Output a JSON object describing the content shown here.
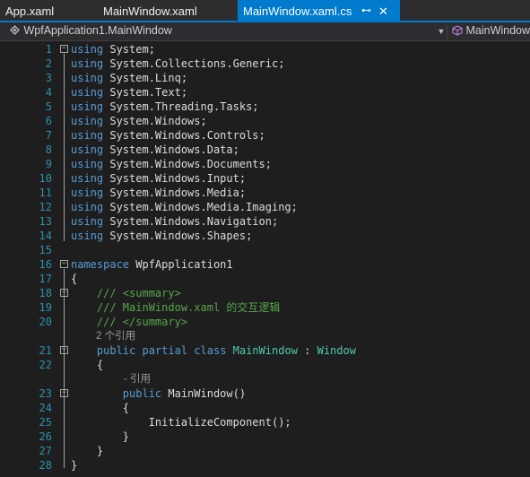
{
  "tabs": [
    {
      "label": "App.xaml",
      "active": false
    },
    {
      "label": "MainWindow.xaml",
      "active": false
    },
    {
      "label": "MainWindow.xaml.cs",
      "active": true
    }
  ],
  "navbar": {
    "class_icon": "cs-class-icon",
    "type_path": "WpfApplication1.MainWindow",
    "member_icon": "cube-member-icon",
    "member": "MainWindow"
  },
  "code_lines": [
    "using System;",
    "using System.Collections.Generic;",
    "using System.Linq;",
    "using System.Text;",
    "using System.Threading.Tasks;",
    "using System.Windows;",
    "using System.Windows.Controls;",
    "using System.Windows.Data;",
    "using System.Windows.Documents;",
    "using System.Windows.Input;",
    "using System.Windows.Media;",
    "using System.Windows.Media.Imaging;",
    "using System.Windows.Navigation;",
    "using System.Windows.Shapes;",
    "",
    "namespace WpfApplication1",
    "{",
    "    /// <summary>",
    "    /// MainWindow.xaml 的交互逻辑",
    "    /// </summary>",
    "    public partial class MainWindow : Window",
    "    {",
    "        public MainWindow()",
    "        {",
    "            InitializeComponent();",
    "        }",
    "    }",
    "}"
  ],
  "codelens": {
    "class_refs": "2 个引用",
    "ctor_refs": "- 引用"
  },
  "colors": {
    "keyword": "#569cd6",
    "comment": "#57a64a",
    "type": "#4ec9b0",
    "line_number": "#2b91af",
    "accent": "#007acc"
  }
}
